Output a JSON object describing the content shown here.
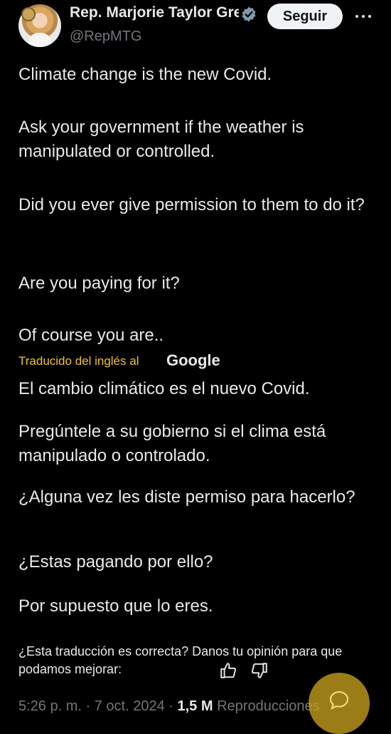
{
  "header": {
    "display_name": "Rep. Marjorie Taylor Greene",
    "handle": "@RepMTG",
    "follow_label": "Seguir",
    "verified_icon": "verified-badge-icon",
    "more_icon": "more-options-icon"
  },
  "tweet": {
    "original": [
      "Climate change is the new Covid.",
      "Ask your government if the weather is manipulated or controlled.",
      "Did you ever give permission to them to do it?",
      "Are you paying for it?",
      "Of course you are.."
    ],
    "translated_label": "Traducido del inglés al",
    "translated_by": "Google",
    "translation": [
      "El cambio climático es el nuevo Covid.",
      "Pregúntele a su gobierno si el clima está manipulado o controlado.",
      "¿Alguna vez les diste permiso para hacerlo?",
      "¿Estas pagando por ello?",
      "Por supuesto que lo eres."
    ],
    "feedback_prompt": "¿Esta traducción es correcta? Danos tu opinión para que podamos mejorar:",
    "time": "5:26 p. m.",
    "date": "7 oct. 2024",
    "separator": "·",
    "views_count": "1,5 M",
    "views_label": "Reproducciones"
  },
  "colors": {
    "background": "#000000",
    "text": "#e7e9ea",
    "muted": "#71767b",
    "translation_label": "#f0c233",
    "fab": "#c6a01e",
    "verified": "#829aab"
  }
}
